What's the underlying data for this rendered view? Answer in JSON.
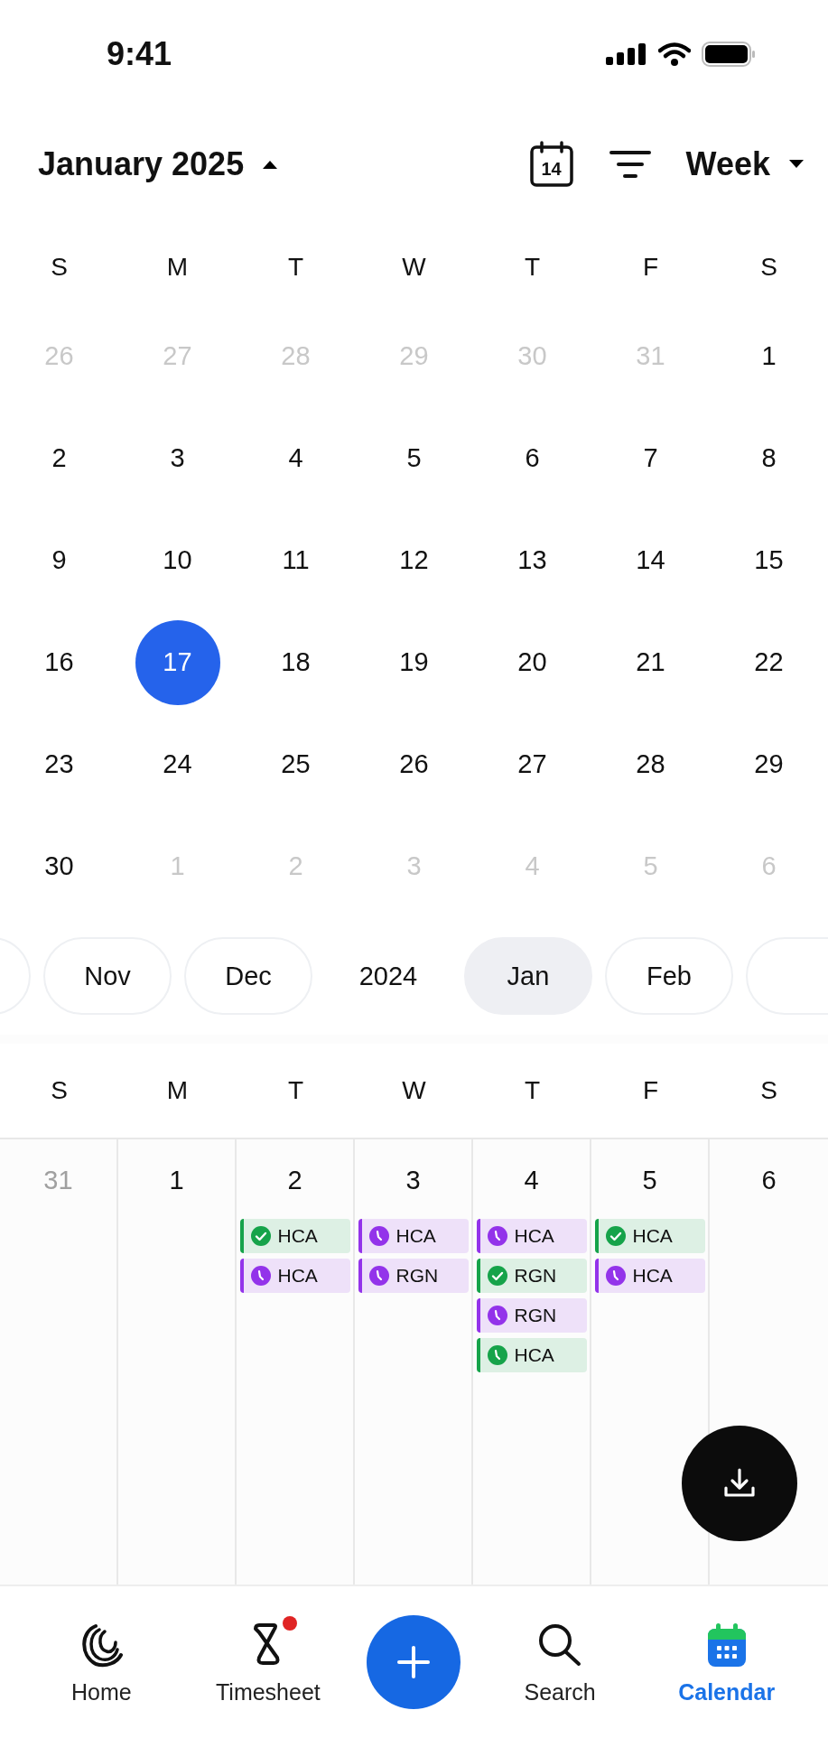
{
  "status_bar": {
    "time": "9:41"
  },
  "header": {
    "title": "January 2025",
    "expanded": true,
    "today_badge": "14",
    "view": "Week"
  },
  "month": {
    "weekdays": [
      "S",
      "M",
      "T",
      "W",
      "T",
      "F",
      "S"
    ],
    "weeks": [
      [
        {
          "day": "26",
          "muted": true,
          "selected": false
        },
        {
          "day": "27",
          "muted": true,
          "selected": false
        },
        {
          "day": "28",
          "muted": true,
          "selected": false
        },
        {
          "day": "29",
          "muted": true,
          "selected": false
        },
        {
          "day": "30",
          "muted": true,
          "selected": false
        },
        {
          "day": "31",
          "muted": true,
          "selected": false
        },
        {
          "day": "1",
          "muted": false,
          "selected": false
        }
      ],
      [
        {
          "day": "2",
          "muted": false,
          "selected": false
        },
        {
          "day": "3",
          "muted": false,
          "selected": false
        },
        {
          "day": "4",
          "muted": false,
          "selected": false
        },
        {
          "day": "5",
          "muted": false,
          "selected": false
        },
        {
          "day": "6",
          "muted": false,
          "selected": false
        },
        {
          "day": "7",
          "muted": false,
          "selected": false
        },
        {
          "day": "8",
          "muted": false,
          "selected": false
        }
      ],
      [
        {
          "day": "9",
          "muted": false,
          "selected": false
        },
        {
          "day": "10",
          "muted": false,
          "selected": false
        },
        {
          "day": "11",
          "muted": false,
          "selected": false
        },
        {
          "day": "12",
          "muted": false,
          "selected": false
        },
        {
          "day": "13",
          "muted": false,
          "selected": false
        },
        {
          "day": "14",
          "muted": false,
          "selected": false
        },
        {
          "day": "15",
          "muted": false,
          "selected": false
        }
      ],
      [
        {
          "day": "16",
          "muted": false,
          "selected": false
        },
        {
          "day": "17",
          "muted": false,
          "selected": true
        },
        {
          "day": "18",
          "muted": false,
          "selected": false
        },
        {
          "day": "19",
          "muted": false,
          "selected": false
        },
        {
          "day": "20",
          "muted": false,
          "selected": false
        },
        {
          "day": "21",
          "muted": false,
          "selected": false
        },
        {
          "day": "22",
          "muted": false,
          "selected": false
        }
      ],
      [
        {
          "day": "23",
          "muted": false,
          "selected": false
        },
        {
          "day": "24",
          "muted": false,
          "selected": false
        },
        {
          "day": "25",
          "muted": false,
          "selected": false
        },
        {
          "day": "26",
          "muted": false,
          "selected": false
        },
        {
          "day": "27",
          "muted": false,
          "selected": false
        },
        {
          "day": "28",
          "muted": false,
          "selected": false
        },
        {
          "day": "29",
          "muted": false,
          "selected": false
        }
      ],
      [
        {
          "day": "30",
          "muted": false,
          "selected": false
        },
        {
          "day": "1",
          "muted": true,
          "selected": false
        },
        {
          "day": "2",
          "muted": true,
          "selected": false
        },
        {
          "day": "3",
          "muted": true,
          "selected": false
        },
        {
          "day": "4",
          "muted": true,
          "selected": false
        },
        {
          "day": "5",
          "muted": true,
          "selected": false
        },
        {
          "day": "6",
          "muted": true,
          "selected": false
        }
      ]
    ]
  },
  "month_strip": [
    {
      "kind": "partial"
    },
    {
      "kind": "month",
      "label": "Nov",
      "selected": false
    },
    {
      "kind": "month",
      "label": "Dec",
      "selected": false
    },
    {
      "kind": "year",
      "label": "2024"
    },
    {
      "kind": "month",
      "label": "Jan",
      "selected": true
    },
    {
      "kind": "month",
      "label": "Feb",
      "selected": false
    },
    {
      "kind": "partial"
    }
  ],
  "week": {
    "weekdays": [
      "S",
      "M",
      "T",
      "W",
      "T",
      "F",
      "S"
    ],
    "days": [
      {
        "date": "31",
        "muted": true
      },
      {
        "date": "1",
        "muted": false
      },
      {
        "date": "2",
        "muted": false,
        "events": [
          {
            "label": "HCA",
            "kind": "confirmed",
            "color": "#16a34a"
          },
          {
            "label": "HCA",
            "kind": "pending",
            "color": "#9333ea"
          }
        ]
      },
      {
        "date": "3",
        "muted": false,
        "events": [
          {
            "label": "HCA",
            "kind": "pending",
            "color": "#9333ea"
          },
          {
            "label": "RGN",
            "kind": "pending",
            "color": "#9333ea"
          }
        ]
      },
      {
        "date": "4",
        "muted": false,
        "events": [
          {
            "label": "HCA",
            "kind": "pending",
            "color": "#9333ea"
          },
          {
            "label": "RGN",
            "kind": "confirmed",
            "color": "#16a34a"
          },
          {
            "label": "RGN",
            "kind": "pending",
            "color": "#9333ea"
          },
          {
            "label": "HCA",
            "kind": "pending",
            "color": "#16a34a"
          }
        ]
      },
      {
        "date": "5",
        "muted": false,
        "events": [
          {
            "label": "HCA",
            "kind": "confirmed",
            "color": "#16a34a"
          },
          {
            "label": "HCA",
            "kind": "pending",
            "color": "#9333ea"
          }
        ]
      },
      {
        "date": "6",
        "muted": false
      }
    ]
  },
  "tab_bar": [
    {
      "kind": "home",
      "label": "Home",
      "selected": false,
      "badge": false
    },
    {
      "kind": "timesheet",
      "label": "Timesheet",
      "selected": false,
      "badge": true
    },
    {
      "kind": "add"
    },
    {
      "kind": "search",
      "label": "Search",
      "selected": false,
      "badge": false
    },
    {
      "kind": "calendar",
      "label": "Calendar",
      "selected": true,
      "badge": false
    }
  ]
}
